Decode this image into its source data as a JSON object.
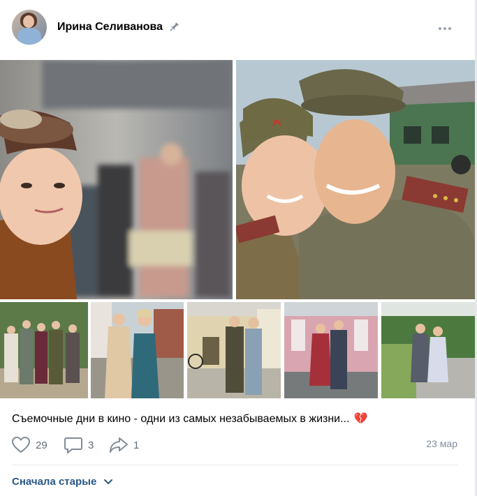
{
  "post": {
    "author_name": "Ирина Селиванова",
    "pin_icon": "pin-icon",
    "more_icon": "more-dots-icon",
    "caption": "Съемочные дни в кино - одни из самых незабываемых в жизни...",
    "caption_emoji": "💔",
    "likes_count": "29",
    "comments_count": "3",
    "shares_count": "1",
    "date": "23 мар",
    "sort_label": "Сначала старые"
  },
  "photos": {
    "count": 7
  },
  "colors": {
    "link": "#2a5885",
    "secondary_text": "#818c99",
    "icon": "#626d7a",
    "divider": "#e7e8ec"
  }
}
